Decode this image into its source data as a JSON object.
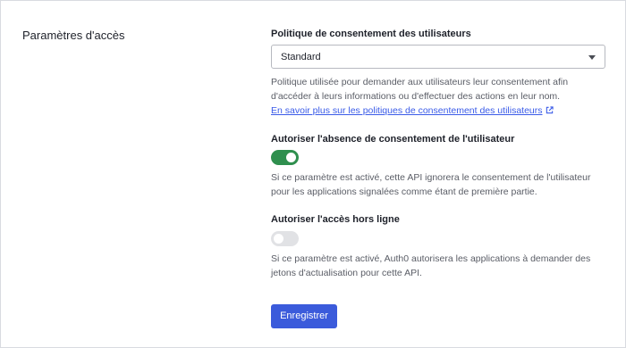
{
  "section": {
    "title": "Paramètres d'accès"
  },
  "consent_policy": {
    "label": "Politique de consentement des utilisateurs",
    "selected": "Standard",
    "help_line1": "Politique utilisée pour demander aux utilisateurs leur consentement afin",
    "help_line2": "d'accéder à leurs informations ou d'effectuer des actions en leur nom.",
    "link_text": "En savoir plus sur les politiques de consentement des utilisateurs",
    "link_icon": "external-link-icon"
  },
  "skip_consent": {
    "label": "Autoriser l'absence de consentement de l'utilisateur",
    "enabled": true,
    "help_line1": "Si ce paramètre est activé, cette API ignorera le consentement de l'utilisateur",
    "help_line2": "pour les applications signalées comme étant de première partie."
  },
  "offline_access": {
    "label": "Autoriser l'accès hors ligne",
    "enabled": false,
    "help_line1": "Si ce paramètre est activé, Auth0 autorisera les applications à demander des",
    "help_line2": "jetons d'actualisation pour cette API."
  },
  "actions": {
    "save_label": "Enregistrer"
  },
  "colors": {
    "accent": "#3b5bdb",
    "toggle_on": "#2f8f4e",
    "toggle_off": "#e1e2e5",
    "link": "#3a5be8"
  }
}
